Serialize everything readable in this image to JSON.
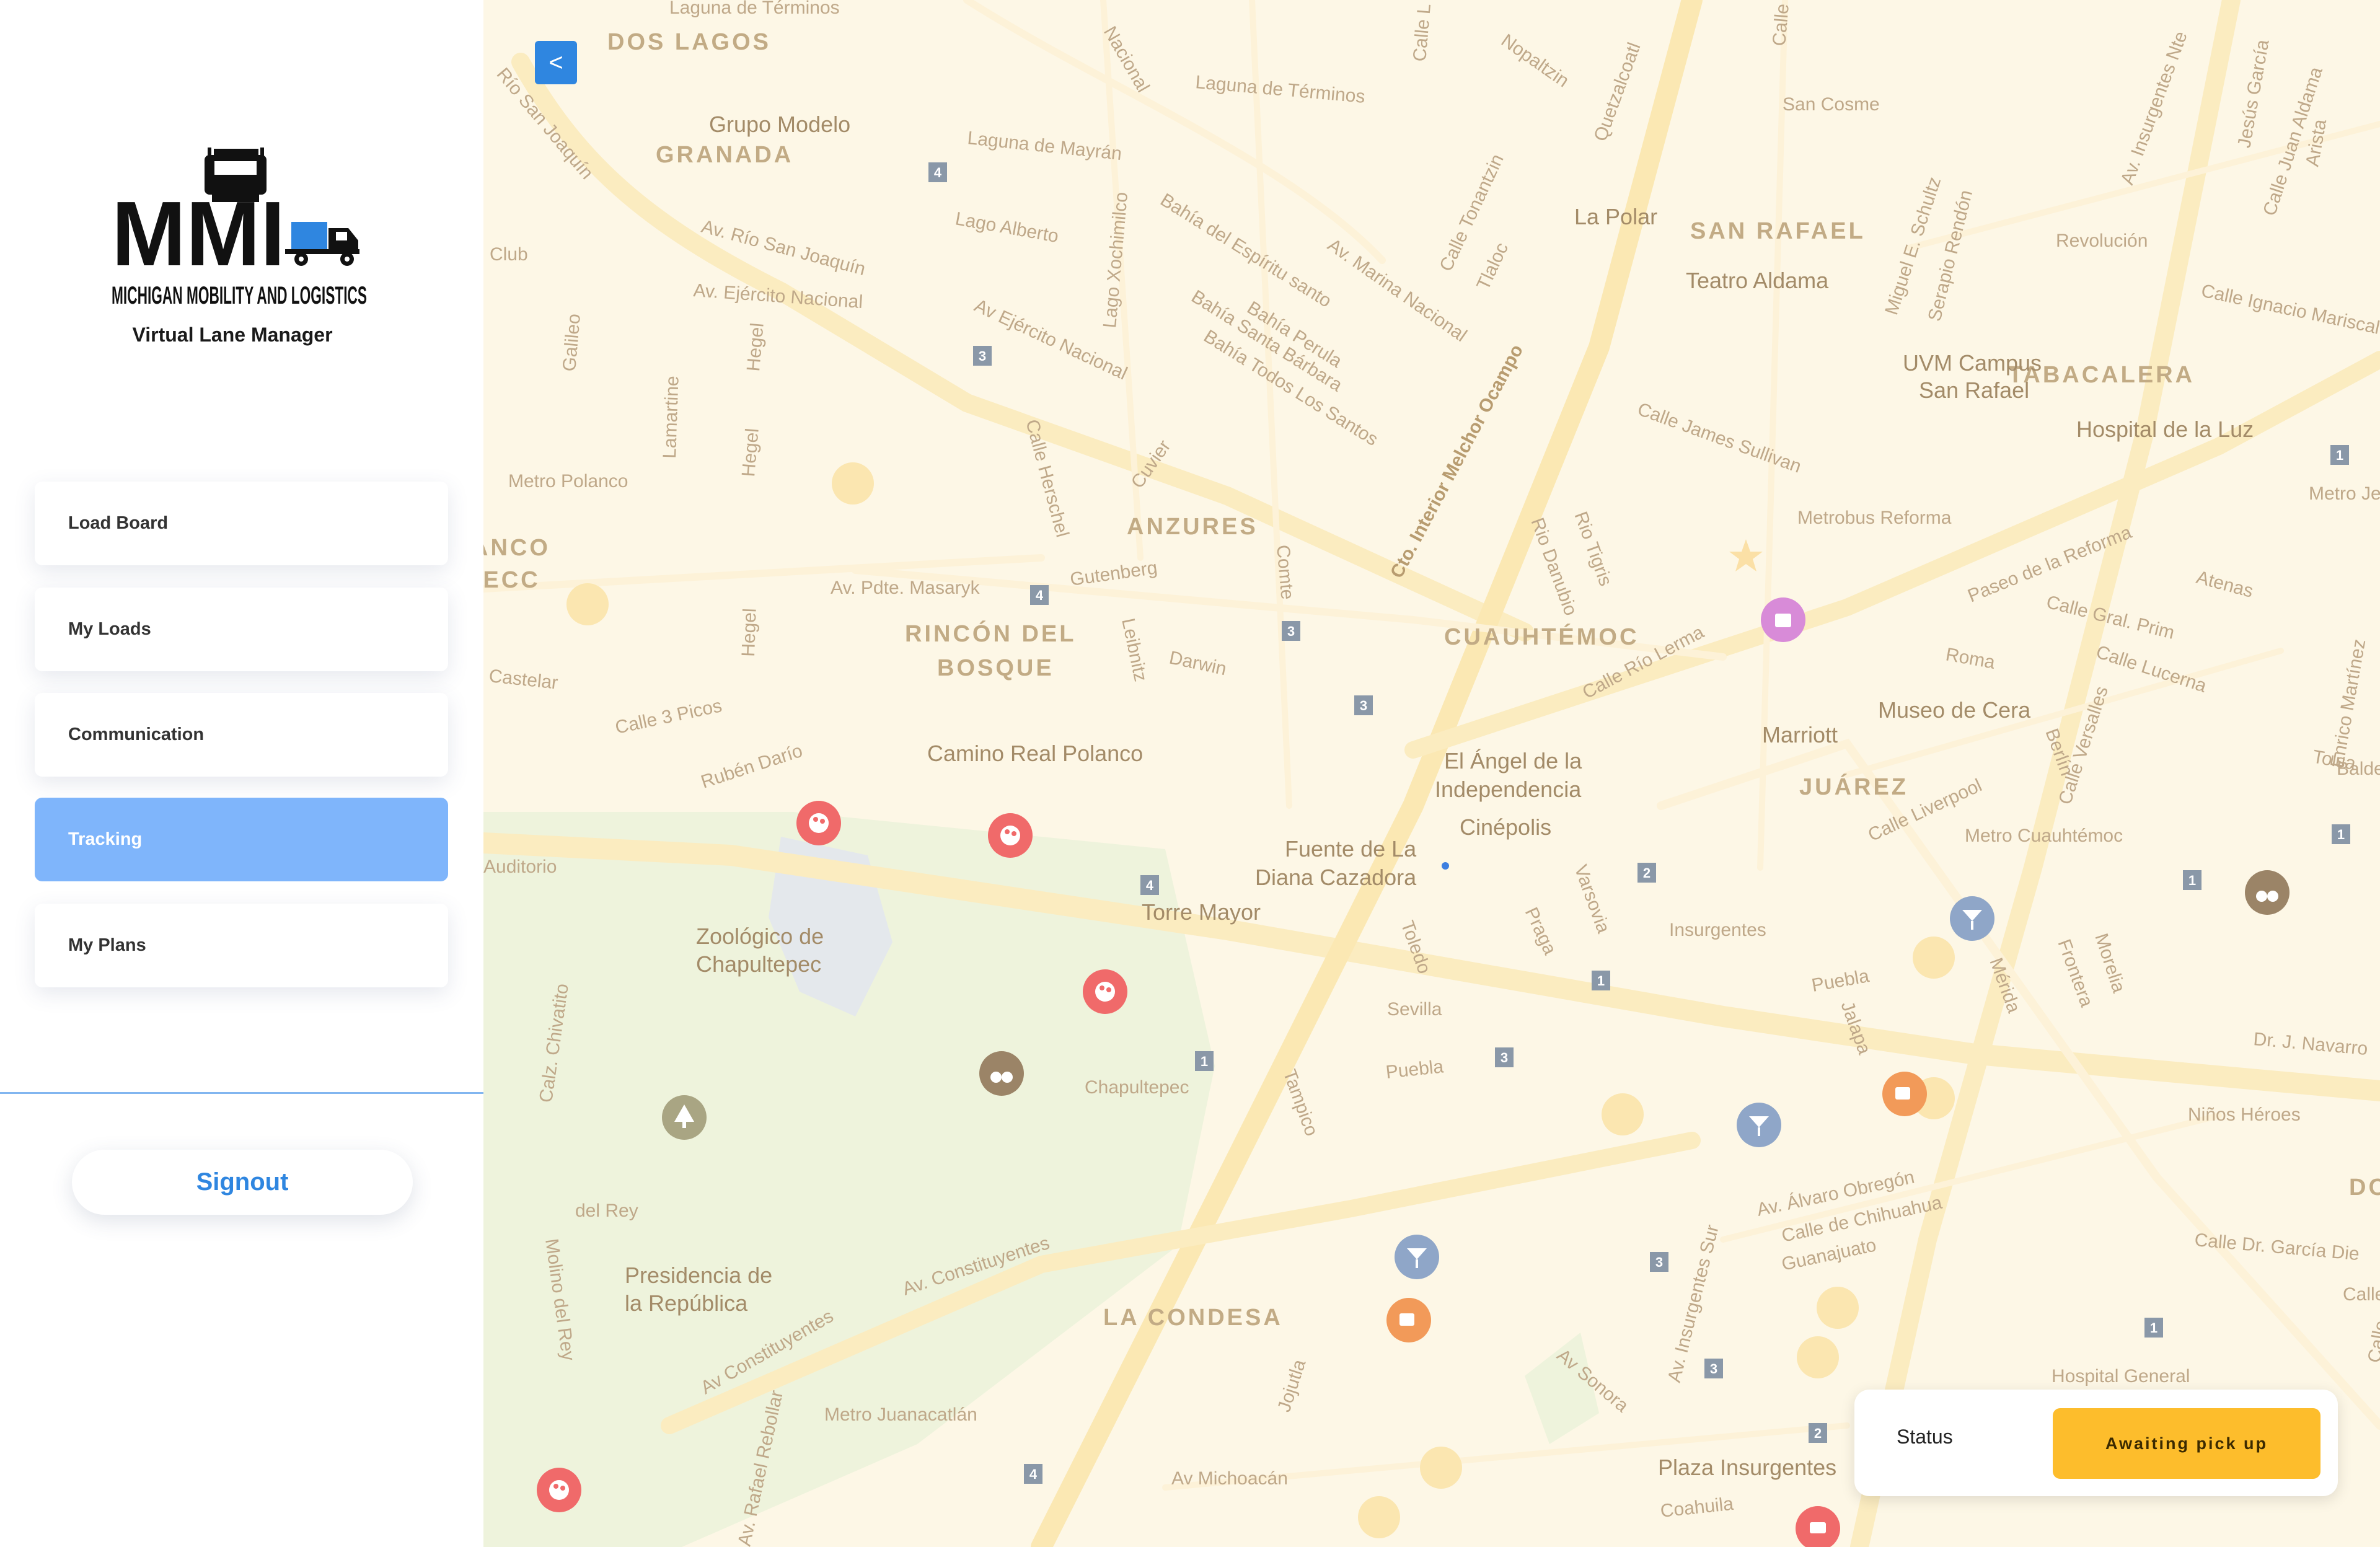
{
  "brand": {
    "logo_text": "MMI",
    "logo_subtitle": "MICHIGAN MOBILITY AND LOGISTICS",
    "tagline": "Virtual Lane Manager"
  },
  "nav": {
    "items": [
      {
        "label": "Load Board",
        "active": false
      },
      {
        "label": "My Loads",
        "active": false
      },
      {
        "label": "Communication",
        "active": false
      },
      {
        "label": "Tracking",
        "active": true
      },
      {
        "label": "My Plans",
        "active": false
      }
    ]
  },
  "signout_label": "Signout",
  "collapse_label": "<",
  "status": {
    "label": "Status",
    "value": "Awaiting pick up"
  },
  "colors": {
    "accent": "#2f86e0",
    "active_nav": "#7fb5fb",
    "status_badge": "#fdbd2c",
    "map_bg": "#fdf7e6",
    "park": "#eef3dc",
    "poi_art": "#f06a6a",
    "poi_bar": "#8fa6c8",
    "poi_cafe": "#f29a59",
    "poi_landmark": "#9b8467"
  },
  "map": {
    "district_labels": [
      "DOS LAGOS",
      "GRANADA",
      "SAN RAFAEL",
      "TABACALERA",
      "ANZURES",
      "RINCÓN DEL",
      "BOSQUE",
      "CUAUHTÉMOC",
      "JUÁREZ",
      "LA CONDESA",
      "ANCO",
      "SECC",
      "DC"
    ],
    "street_labels": [
      "Laguna de Términos",
      "Laguna de Términos",
      "Laguna de Mayrán",
      "Lago Alberto",
      "Av. Río San Joaquín",
      "Río San Joaquín",
      "Av. Ejército Nacional",
      "Av Ejército Nacional",
      "Bahía del Espíritu santo",
      "Bahía Perula",
      "Bahía Santa Bárbara",
      "Bahía Todos Los Santos",
      "Av. Marina Nacional",
      "Cto. Interior Melchor Ocampo",
      "Calle James Sullivan",
      "Paseo de la Reforma",
      "Calle Gral. Prim",
      "Calle Lucerna",
      "Av. Pdte. Masaryk",
      "Gutenberg",
      "Darwin",
      "Calle 3 Picos",
      "Rubén Darío",
      "Calle Río Lerma",
      "Calle Liverpool",
      "Av Constituyentes",
      "Av. Constituyentes",
      "Av. Álvaro Obregón",
      "Calle de Chihuahua",
      "Guanajuato",
      "Av. Insurgentes Sur",
      "Av Sonora",
      "Av Michoacán",
      "Coahuila",
      "Puebla",
      "Puebla",
      "Roma",
      "Atenas",
      "Tolsa",
      "Berlín",
      "Praga",
      "Varsovia",
      "Toledo",
      "Tampico",
      "Mérida",
      "Jalapa",
      "Frontera",
      "Morelia",
      "Dr. J. Navarro",
      "Niños Héroes",
      "Calle Dr. García Die",
      "Calle Ignacio Mariscal",
      "Av. Insurgentes Nte",
      "Jesús García",
      "Calle Juan Aldama",
      "Arista",
      "Miguel E. Schultz",
      "Serapio Rendón",
      "Quetzalcoatl",
      "Nopaltzin",
      "Calle Tonantzin",
      "Tlaloc",
      "Calle Herschel",
      "Leibnitz",
      "Comte",
      "Cuvier",
      "Lago Xochimilco",
      "Galileo",
      "Lamartine",
      "Hegel",
      "Hegel",
      "Hegel",
      "Calz. Chivatito",
      "Molino del Rey",
      "del Rey",
      "Av. Rafael Rebollar",
      "Jojutla",
      "Castelar",
      "Auditorio",
      "Club",
      "Rio Danubio",
      "Rio Tigris",
      "Calle Versalles",
      "Enrico Martínez",
      "Balderas",
      "Nacional",
      "Calle L",
      "Calle",
      "Calle",
      "Calle"
    ],
    "place_labels": [
      "Grupo Modelo",
      "La Polar",
      "Teatro Aldama",
      "UVM Campus",
      "San Rafael",
      "Hospital de la Luz",
      "Camino Real Polanco",
      "El Ángel de la",
      "Independencia",
      "Cinépolis",
      "Fuente de La",
      "Diana Cazadora",
      "Torre Mayor",
      "Museo de Cera",
      "Marriott",
      "Zoológico de",
      "Chapultepec",
      "Presidencia de",
      "la República",
      "Plaza Insurgentes",
      "Hospital General"
    ],
    "metro_labels": [
      "San Cosme",
      "Revolución",
      "Metro Polanco",
      "Metrobus Reforma",
      "Metro Cuauhtémoc",
      "Insurgentes",
      "Sevilla",
      "Chapultepec",
      "Metro Juanacatlán",
      "Metro Je"
    ],
    "route_shields": [
      "4",
      "3",
      "4",
      "3",
      "3",
      "4",
      "2",
      "1",
      "3",
      "1",
      "3",
      "3",
      "2",
      "1",
      "1",
      "1",
      "1",
      "4"
    ],
    "pois": [
      {
        "icon": "art-gallery-icon",
        "type": "art"
      },
      {
        "icon": "art-gallery-icon",
        "type": "art"
      },
      {
        "icon": "art-gallery-icon",
        "type": "art"
      },
      {
        "icon": "art-gallery-icon",
        "type": "art"
      },
      {
        "icon": "bar-icon",
        "type": "bar"
      },
      {
        "icon": "bar-icon",
        "type": "bar"
      },
      {
        "icon": "bar-icon",
        "type": "bar"
      },
      {
        "icon": "cafe-icon",
        "type": "cafe"
      },
      {
        "icon": "cafe-icon",
        "type": "cafe"
      },
      {
        "icon": "binoculars-icon",
        "type": "landmark"
      },
      {
        "icon": "binoculars-icon",
        "type": "landmark"
      },
      {
        "icon": "tree-icon",
        "type": "park"
      },
      {
        "icon": "shopping-icon",
        "type": "shop"
      },
      {
        "icon": "fast-food-icon",
        "type": "food"
      }
    ]
  }
}
